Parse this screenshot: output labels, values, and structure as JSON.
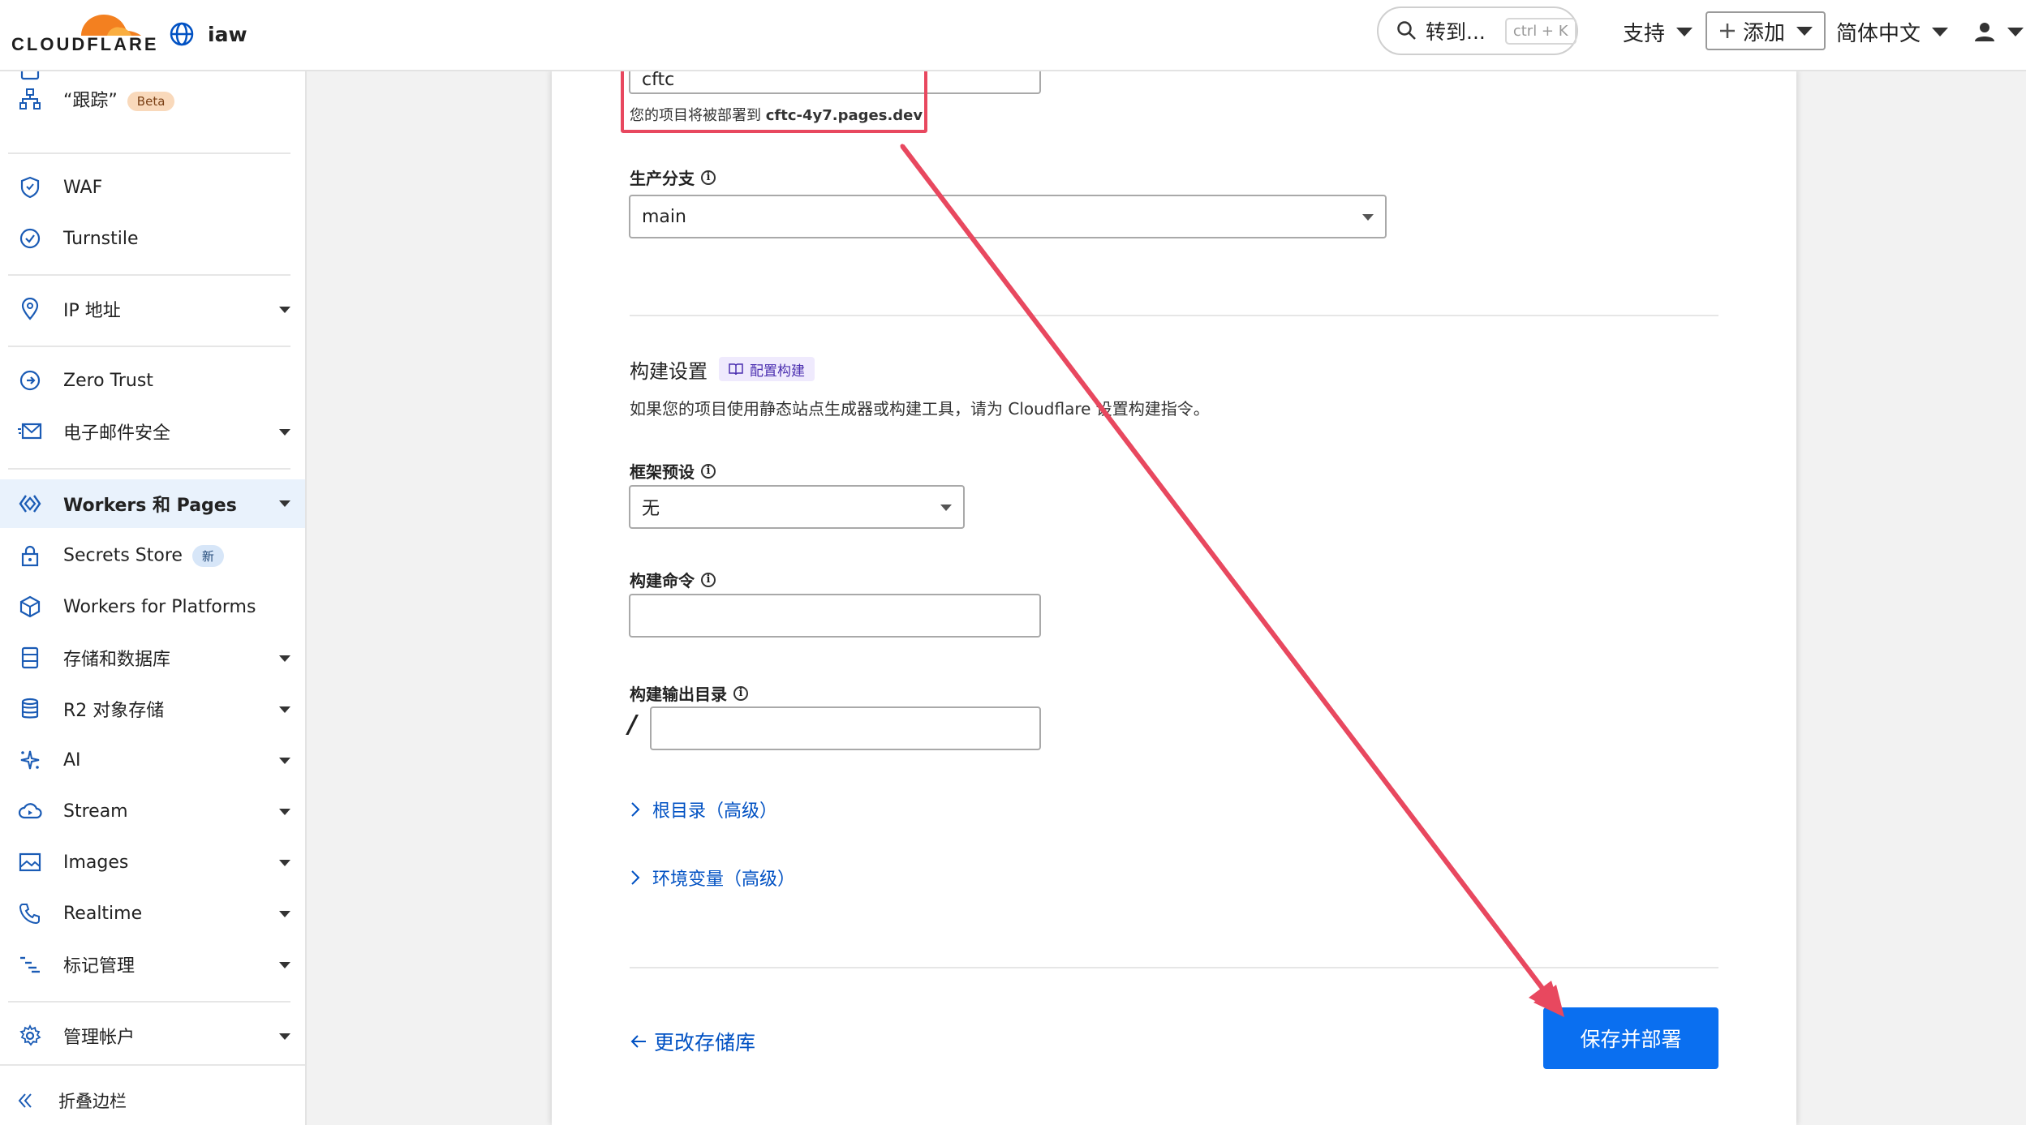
{
  "header": {
    "brand": "CLOUDFLARE",
    "account_name": "iaw",
    "goto_label": "转到...",
    "goto_shortcut": "ctrl + K",
    "support_label": "支持",
    "add_label": "添加",
    "language_label": "简体中文"
  },
  "sidebar": {
    "items": [
      {
        "label": "“跟踪”",
        "badge": "Beta"
      },
      {
        "label": "WAF"
      },
      {
        "label": "Turnstile"
      },
      {
        "label": "IP 地址"
      },
      {
        "label": "Zero Trust"
      },
      {
        "label": "电子邮件安全"
      },
      {
        "label": "Workers 和 Pages"
      },
      {
        "label": "Secrets Store",
        "badge": "新"
      },
      {
        "label": "Workers for Platforms"
      },
      {
        "label": "存储和数据库"
      },
      {
        "label": "R2 对象存储"
      },
      {
        "label": "AI"
      },
      {
        "label": "Stream"
      },
      {
        "label": "Images"
      },
      {
        "label": "Realtime"
      },
      {
        "label": "标记管理"
      },
      {
        "label": "管理帐户"
      }
    ],
    "collapse_label": "折叠边栏"
  },
  "form": {
    "project_name_value": "cftc",
    "deploy_hint_prefix": "您的项目将被部署到",
    "deploy_hint_domain": "cftc-4y7.pages.dev",
    "branch_label": "生产分支",
    "branch_value": "main",
    "build_settings_title": "构建设置",
    "configure_build_link": "配置构建",
    "build_settings_desc": "如果您的项目使用静态站点生成器或构建工具，请为 Cloudflare 设置构建指令。",
    "framework_label": "框架预设",
    "framework_value": "无",
    "build_command_label": "构建命令",
    "build_command_value": "",
    "output_dir_label": "构建输出目录",
    "output_dir_prefix": "/",
    "output_dir_value": "",
    "root_dir_link": "根目录（高级）",
    "env_vars_link": "环境变量（高级）",
    "change_repo_link": "更改存储库",
    "save_deploy_button": "保存并部署"
  },
  "colors": {
    "primary": "#0a6ff0",
    "link": "#0051c3",
    "annotation": "#e8485f",
    "brand_orange": "#f38020"
  }
}
